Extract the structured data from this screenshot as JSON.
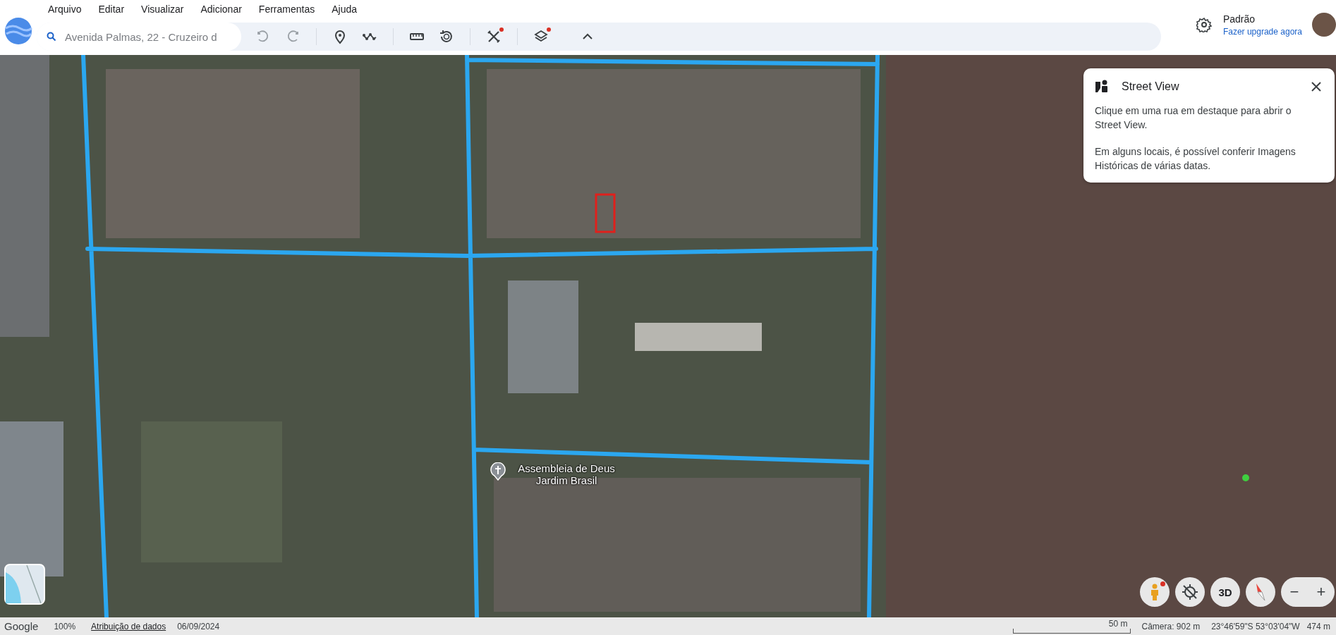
{
  "menu": [
    "Arquivo",
    "Editar",
    "Visualizar",
    "Adicionar",
    "Ferramentas",
    "Ajuda"
  ],
  "search": {
    "value": "Avenida Palmas, 22 - Cruzeiro d"
  },
  "toolbar": [
    {
      "kind": "undo",
      "disabled": true,
      "badge": false
    },
    {
      "kind": "redo",
      "disabled": true,
      "badge": false
    },
    {
      "kind": "pin",
      "disabled": false,
      "badge": false
    },
    {
      "kind": "path",
      "disabled": false,
      "badge": false
    },
    {
      "kind": "ruler",
      "disabled": false,
      "badge": false
    },
    {
      "kind": "history",
      "disabled": false,
      "badge": false
    },
    {
      "kind": "tools",
      "disabled": false,
      "badge": true
    },
    {
      "kind": "layers",
      "disabled": false,
      "badge": true
    },
    {
      "kind": "collapse",
      "disabled": false,
      "badge": false
    }
  ],
  "account": {
    "plan": "Padrão",
    "upgrade_link": "Fazer upgrade agora"
  },
  "street_view_panel": {
    "title": "Street View",
    "paragraphs": [
      "Clique em uma rua em destaque para abrir o Street View.",
      "Em alguns locais, é possível conferir Imagens Históricas de várias datas."
    ]
  },
  "map": {
    "place_label": "Assembleia de Deus Jardim Brasil"
  },
  "map_controls": [
    {
      "kind": "pegman",
      "badge": true
    },
    {
      "kind": "recenter",
      "badge": false
    },
    {
      "kind": "three_d",
      "label": "3D",
      "badge": false
    },
    {
      "kind": "compass",
      "badge": false
    }
  ],
  "zoom_controls": {
    "zoom_out": "−",
    "zoom_in": "+"
  },
  "status_bar": {
    "brand": "Google",
    "zoom": "100%",
    "attribution": "Atribuição de dados",
    "date": "06/09/2024",
    "scale": "50 m",
    "camera": "Câmera: 902 m",
    "coordinates": "23°46'59\"S 53°03'04\"W",
    "elevation": "474 m"
  }
}
